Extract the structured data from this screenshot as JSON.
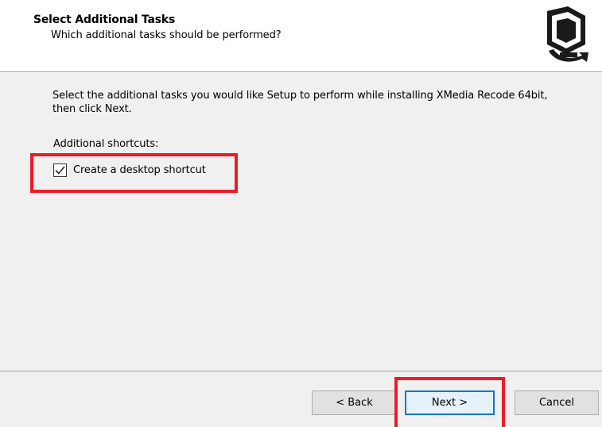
{
  "header": {
    "title": "Select Additional Tasks",
    "subtitle": "Which additional tasks should be performed?",
    "icon": "setup-wizard-icon"
  },
  "main": {
    "description": "Select the additional tasks you would like Setup to perform while installing XMedia Recode 64bit, then click Next.",
    "section_label": "Additional shortcuts:",
    "tasks": [
      {
        "label": "Create a desktop shortcut",
        "checked": true
      }
    ]
  },
  "buttons": {
    "back": "< Back",
    "next": "Next >",
    "cancel": "Cancel"
  },
  "colors": {
    "annotation": "#ee1b24",
    "default_button_border": "#0078d7",
    "panel_background": "#f0f0f0"
  }
}
